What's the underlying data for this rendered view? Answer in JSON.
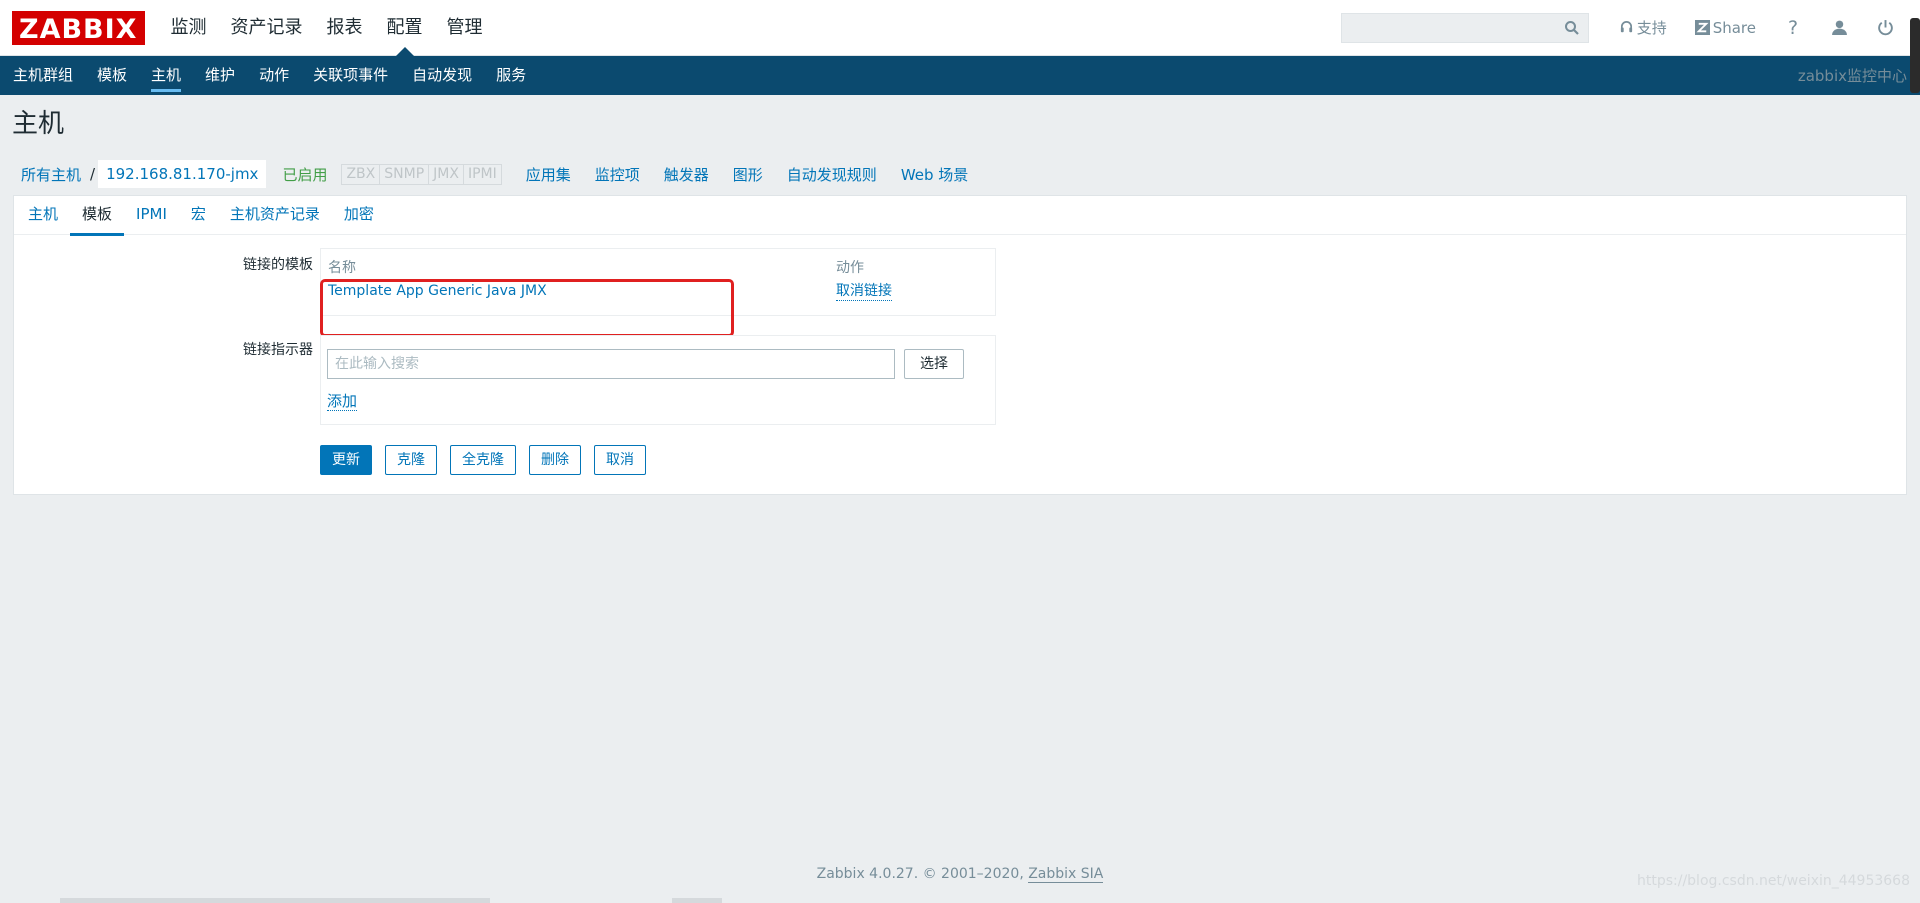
{
  "header": {
    "logo": "ZABBIX",
    "menu": [
      {
        "label": "监测"
      },
      {
        "label": "资产记录"
      },
      {
        "label": "报表"
      },
      {
        "label": "配置"
      },
      {
        "label": "管理"
      }
    ],
    "selected_menu": "配置",
    "search_placeholder": "",
    "support_label": "支持",
    "share_label": "Share",
    "help_label": "?"
  },
  "subnav": {
    "items": [
      {
        "label": "主机群组"
      },
      {
        "label": "模板"
      },
      {
        "label": "主机"
      },
      {
        "label": "维护"
      },
      {
        "label": "动作"
      },
      {
        "label": "关联项事件"
      },
      {
        "label": "自动发现"
      },
      {
        "label": "服务"
      }
    ],
    "active": "主机",
    "server_name": "zabbix监控中心"
  },
  "page": {
    "title": "主机"
  },
  "breadcrumb": {
    "all_hosts": "所有主机",
    "separator": "/",
    "current_host": "192.168.81.170-jmx",
    "status": "已启用",
    "availability": [
      "ZBX",
      "SNMP",
      "JMX",
      "IPMI"
    ],
    "tabs": [
      "应用集",
      "监控项",
      "触发器",
      "图形",
      "自动发现规则",
      "Web 场景"
    ]
  },
  "form_tabs": {
    "items": [
      "主机",
      "模板",
      "IPMI",
      "宏",
      "主机资产记录",
      "加密"
    ],
    "active": "模板"
  },
  "linked_templates": {
    "label": "链接的模板",
    "col_name": "名称",
    "col_action": "动作",
    "rows": [
      {
        "name": "Template App Generic Java JMX",
        "action": "取消链接"
      }
    ]
  },
  "link_indicator": {
    "label": "链接指示器",
    "placeholder": "在此输入搜索",
    "select_button": "选择",
    "add_link": "添加"
  },
  "buttons": {
    "update": "更新",
    "clone": "克隆",
    "full_clone": "全克隆",
    "delete": "删除",
    "cancel": "取消"
  },
  "footer": {
    "text": "Zabbix 4.0.27. © 2001–2020,",
    "company": "Zabbix SIA"
  },
  "watermark": "https://blog.csdn.net/weixin_44953668",
  "colors": {
    "brand_red": "#d40000",
    "nav_dark": "#0b4a6f",
    "link_blue": "#0275b8",
    "enabled_green": "#429e47",
    "highlight_red": "#e02020"
  }
}
